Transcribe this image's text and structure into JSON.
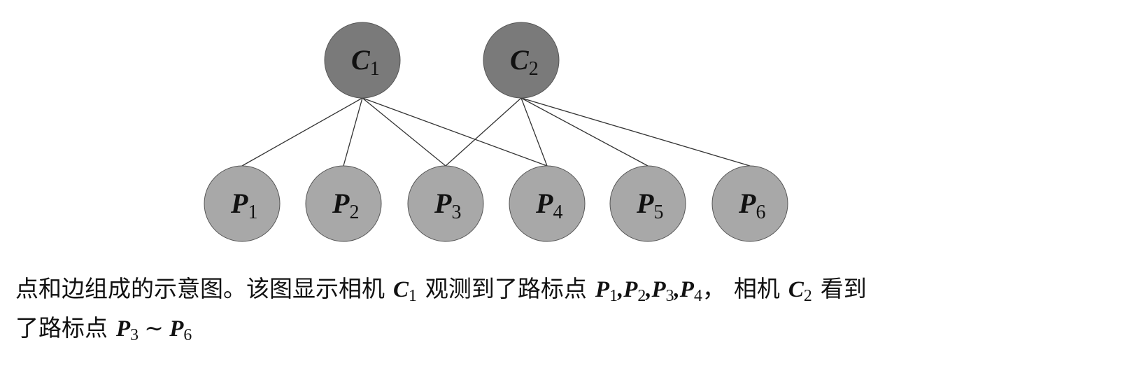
{
  "diagram": {
    "cameras": [
      {
        "id": "C1",
        "letter": "C",
        "sub": "1"
      },
      {
        "id": "C2",
        "letter": "C",
        "sub": "2"
      }
    ],
    "landmarks": [
      {
        "id": "P1",
        "letter": "P",
        "sub": "1"
      },
      {
        "id": "P2",
        "letter": "P",
        "sub": "2"
      },
      {
        "id": "P3",
        "letter": "P",
        "sub": "3"
      },
      {
        "id": "P4",
        "letter": "P",
        "sub": "4"
      },
      {
        "id": "P5",
        "letter": "P",
        "sub": "5"
      },
      {
        "id": "P6",
        "letter": "P",
        "sub": "6"
      }
    ],
    "edges": [
      [
        "C1",
        "P1"
      ],
      [
        "C1",
        "P2"
      ],
      [
        "C1",
        "P3"
      ],
      [
        "C1",
        "P4"
      ],
      [
        "C2",
        "P3"
      ],
      [
        "C2",
        "P4"
      ],
      [
        "C2",
        "P5"
      ],
      [
        "C2",
        "P6"
      ]
    ],
    "colors": {
      "camera_fill": "#7a7a7a",
      "landmark_fill": "#a8a8a8",
      "node_stroke": "#555555"
    }
  },
  "caption": {
    "line1_a": "点和边组成的示意图。该图显示相机",
    "c1_letter": "C",
    "c1_sub": "1",
    "line1_b": "观测到了路标点",
    "p1_letter": "P",
    "p1_sub": "1",
    "p2_letter": "P",
    "p2_sub": "2",
    "p3_letter": "P",
    "p3_sub": "3",
    "p4_letter": "P",
    "p4_sub": "4",
    "comma": ",",
    "fullwidth_comma": "，",
    "line1_c": "相机",
    "c2_letter": "C",
    "c2_sub": "2",
    "line1_d": "看到",
    "line2_a": "了路标点",
    "range_from_letter": "P",
    "range_from_sub": "3",
    "tilde": "∼",
    "range_to_letter": "P",
    "range_to_sub": "6"
  }
}
